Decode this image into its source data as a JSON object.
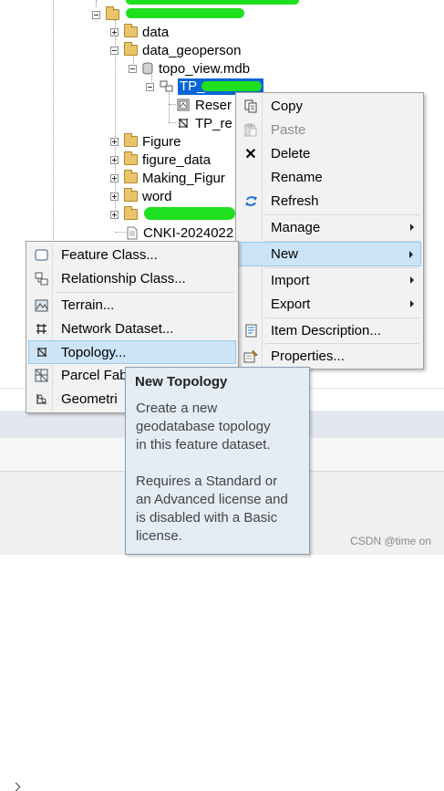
{
  "tree": {
    "items": [
      {
        "label": "data"
      },
      {
        "label": "data_geoperson"
      },
      {
        "label": "topo_view.mdb"
      },
      {
        "label": "TP_"
      },
      {
        "label": "Reser"
      },
      {
        "label": "TP_re"
      },
      {
        "label": "Figure"
      },
      {
        "label": "figure_data"
      },
      {
        "label": "Making_Figur"
      },
      {
        "label": "word"
      },
      {
        "label": ""
      },
      {
        "label": "CNKI-2024022"
      }
    ]
  },
  "context_menu": {
    "items": [
      {
        "label": "Copy",
        "icon": "copy-icon"
      },
      {
        "label": "Paste",
        "icon": "paste-icon",
        "disabled": true
      },
      {
        "label": "Delete",
        "icon": "delete-icon"
      },
      {
        "label": "Rename"
      },
      {
        "label": "Refresh",
        "icon": "refresh-icon"
      },
      {
        "label": "Manage",
        "submenu": true
      },
      {
        "label": "New",
        "submenu": true,
        "highlighted": true
      },
      {
        "label": "Import",
        "submenu": true
      },
      {
        "label": "Export",
        "submenu": true
      },
      {
        "label": "Item Description...",
        "icon": "item-description-icon"
      },
      {
        "label": "Properties...",
        "icon": "properties-icon"
      }
    ]
  },
  "new_submenu": {
    "items": [
      {
        "label": "Feature Class...",
        "icon": "feature-class-icon"
      },
      {
        "label": "Relationship Class...",
        "icon": "relationship-class-icon"
      },
      {
        "label": "Terrain...",
        "icon": "terrain-icon"
      },
      {
        "label": "Network Dataset...",
        "icon": "network-dataset-icon"
      },
      {
        "label": "Topology...",
        "icon": "topology-icon",
        "highlighted": true
      },
      {
        "label": "Parcel Fab",
        "icon": "parcel-fabric-icon"
      },
      {
        "label": "Geometri",
        "icon": "geometric-network-icon"
      }
    ]
  },
  "tooltip": {
    "title": "New Topology",
    "body": "Create a new\ngeodatabase topology\nin this feature dataset.\n\nRequires a Standard or\nan Advanced license and\nis disabled with a Basic\nlicense."
  },
  "watermark": "CSDN @time on",
  "colors": {
    "highlight_bg": "#cce4f7",
    "selected_node_bg": "#0a64d6",
    "tooltip_bg": "#e4ecf4",
    "redaction": "#1ee01e"
  }
}
